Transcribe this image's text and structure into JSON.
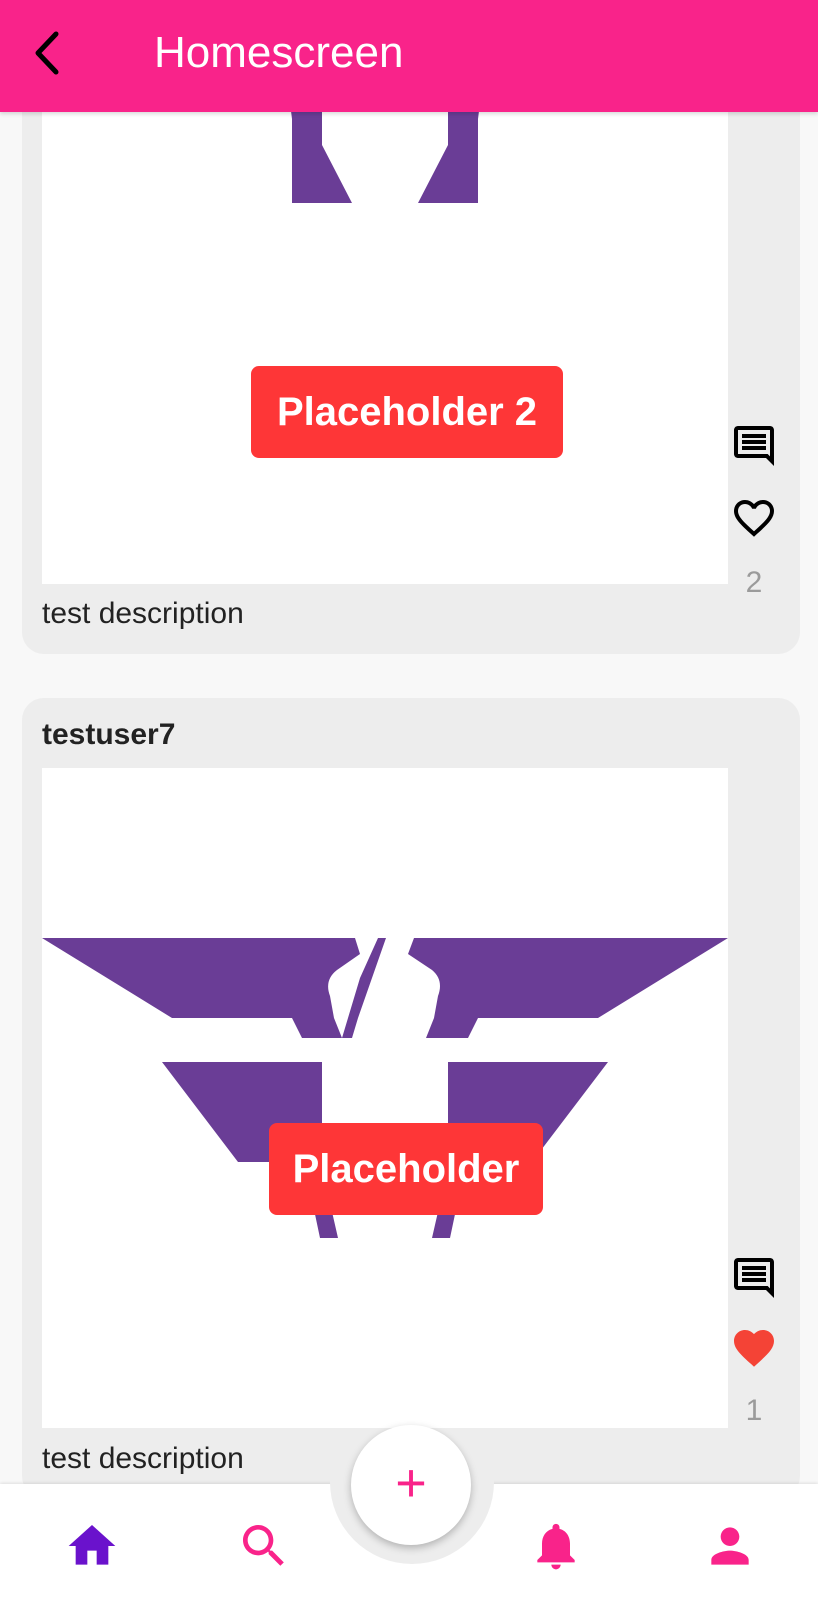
{
  "app_bar": {
    "title": "Homescreen",
    "color": "#f9238a"
  },
  "posts": [
    {
      "username": "",
      "image_label": "Placeholder 2",
      "description": "test description",
      "likes": "2",
      "liked": false
    },
    {
      "username": "testuser7",
      "image_label": "Placeholder",
      "description": "test description",
      "likes": "1",
      "liked": true
    }
  ],
  "fab": {
    "label": "+"
  },
  "bottom_nav": {
    "items": [
      {
        "icon": "home-icon",
        "active": true
      },
      {
        "icon": "search-icon",
        "active": false
      },
      {
        "icon": "bell-icon",
        "active": false
      },
      {
        "icon": "person-icon",
        "active": false
      }
    ],
    "active_color": "#6a12cc",
    "inactive_color": "#f9238a"
  },
  "colors": {
    "logo_purple": "#6a3d96",
    "badge_red": "#fe3637",
    "like_red": "#f44336"
  }
}
